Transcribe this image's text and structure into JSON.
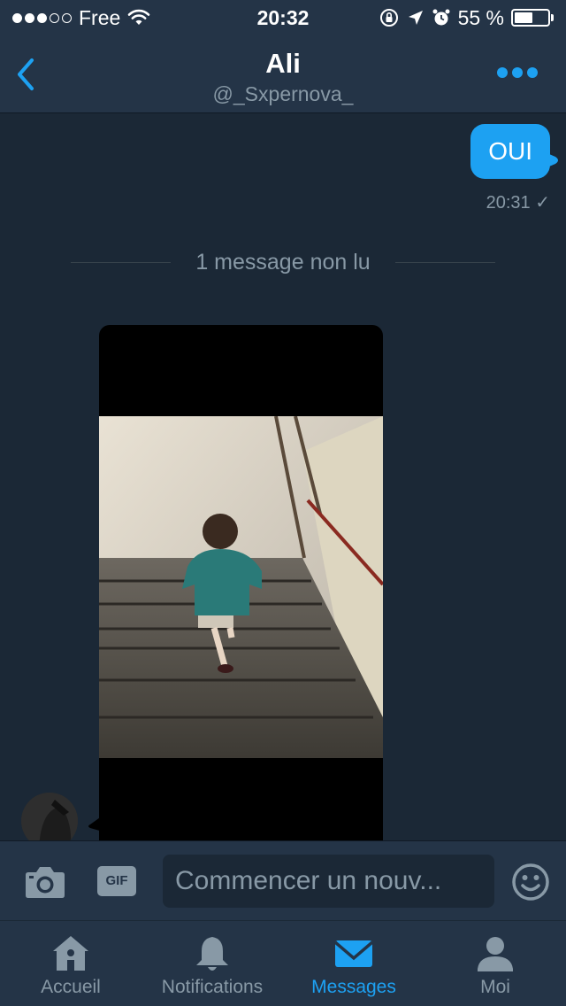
{
  "status_bar": {
    "carrier": "Free",
    "time": "20:32",
    "battery_percent": "55 %",
    "battery_level": 0.55,
    "signal_bars_filled": 3,
    "signal_bars_total": 5
  },
  "header": {
    "name": "Ali",
    "handle": "@_Sxpernova_"
  },
  "chat": {
    "outgoing_message": {
      "text": "OUI",
      "time": "20:31 ✓"
    },
    "unread_divider": "1 message non lu"
  },
  "composer": {
    "gif_label": "GIF",
    "placeholder": "Commencer un nouv..."
  },
  "tabs": [
    {
      "label": "Accueil",
      "icon": "home-icon",
      "active": false
    },
    {
      "label": "Notifications",
      "icon": "bell-icon",
      "active": false
    },
    {
      "label": "Messages",
      "icon": "envelope-icon",
      "active": true
    },
    {
      "label": "Moi",
      "icon": "person-icon",
      "active": false
    }
  ],
  "colors": {
    "background": "#1b2836",
    "bar": "#243447",
    "accent": "#1da1f2",
    "muted": "#8899a6"
  }
}
